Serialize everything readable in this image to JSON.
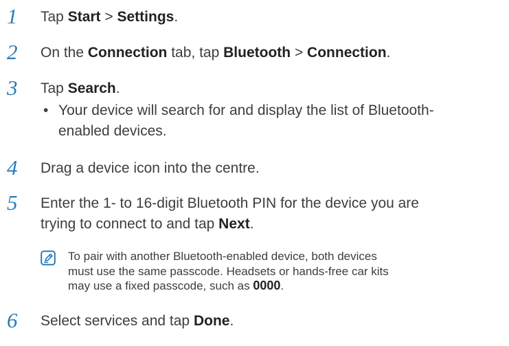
{
  "steps": [
    {
      "num": "1",
      "t1": "Tap ",
      "b1": "Start",
      "t2": " > ",
      "b2": "Settings",
      "t3": "."
    },
    {
      "num": "2",
      "t1": "On the ",
      "b1": "Connection",
      "t2": " tab, tap ",
      "b2": "Bluetooth",
      "t3": " > ",
      "b3": "Connection",
      "t4": "."
    },
    {
      "num": "3",
      "t1": "Tap ",
      "b1": "Search",
      "t2": ".",
      "bullet": "•",
      "sub_line1": "Your device will search for and display the list of Bluetooth-",
      "sub_line2": "enabled devices."
    },
    {
      "num": "4",
      "t1": "Drag a device icon into the centre."
    },
    {
      "num": "5",
      "line1": "Enter the 1- to 16-digit Bluetooth PIN for the device you are",
      "t1": "trying to connect to and tap ",
      "b1": "Next",
      "t2": "."
    },
    {
      "num": "6",
      "t1": "Select services and tap ",
      "b1": "Done",
      "t2": "."
    }
  ],
  "note": {
    "icon": "note-pencil-icon",
    "line1": "To pair with another Bluetooth-enabled device, both devices",
    "line2": "must use the same passcode. Headsets or hands-free car kits",
    "line3a": "may use a fixed passcode, such as ",
    "line3b": "0000",
    "line3c": "."
  },
  "colors": {
    "step_number": "#2a7bb8",
    "text": "#3d3d3d",
    "icon": "#2a7bb8"
  }
}
